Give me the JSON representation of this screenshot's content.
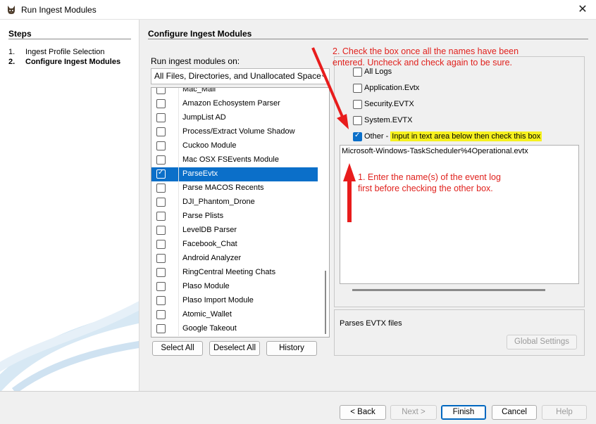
{
  "window": {
    "title": "Run Ingest Modules",
    "icon": "autopsy-dog-icon",
    "close_icon": "close-icon"
  },
  "steps": {
    "title": "Steps",
    "items": [
      {
        "num": "1.",
        "label": "Ingest Profile Selection"
      },
      {
        "num": "2.",
        "label": "Configure Ingest Modules"
      }
    ]
  },
  "main": {
    "title": "Configure Ingest Modules",
    "run_on_label": "Run ingest modules on:",
    "scope_value": "All Files, Directories, and Unallocated Space"
  },
  "modules": [
    {
      "name": "Mac_Mail",
      "checked": false,
      "selected": false
    },
    {
      "name": "Amazon Echosystem Parser",
      "checked": false,
      "selected": false
    },
    {
      "name": "JumpList AD",
      "checked": false,
      "selected": false
    },
    {
      "name": "Process/Extract Volume Shadow",
      "checked": false,
      "selected": false
    },
    {
      "name": "Cuckoo Module",
      "checked": false,
      "selected": false
    },
    {
      "name": "Mac OSX FSEvents Module",
      "checked": false,
      "selected": false
    },
    {
      "name": "ParseEvtx",
      "checked": true,
      "selected": true
    },
    {
      "name": "Parse MACOS Recents",
      "checked": false,
      "selected": false
    },
    {
      "name": "DJI_Phantom_Drone",
      "checked": false,
      "selected": false
    },
    {
      "name": "Parse Plists",
      "checked": false,
      "selected": false
    },
    {
      "name": "LevelDB Parser",
      "checked": false,
      "selected": false
    },
    {
      "name": "Facebook_Chat",
      "checked": false,
      "selected": false
    },
    {
      "name": "Android Analyzer",
      "checked": false,
      "selected": false
    },
    {
      "name": "RingCentral Meeting Chats",
      "checked": false,
      "selected": false
    },
    {
      "name": "Plaso Module",
      "checked": false,
      "selected": false
    },
    {
      "name": "Plaso Import Module",
      "checked": false,
      "selected": false
    },
    {
      "name": "Atomic_Wallet",
      "checked": false,
      "selected": false
    },
    {
      "name": "Google Takeout",
      "checked": false,
      "selected": false
    }
  ],
  "list_buttons": {
    "select_all": "Select All",
    "deselect_all": "Deselect All",
    "history": "History"
  },
  "settings": {
    "all_logs": "All Logs",
    "application": "Application.Evtx",
    "security": "Security.EVTX",
    "system": "System.EVTX",
    "other_label": "Other -",
    "other_hint": "Input in text area below then check this box",
    "other_checked": true,
    "log_text": "Microsoft-Windows-TaskScheduler%4Operational.evtx"
  },
  "description": {
    "text": "Parses EVTX files",
    "global_settings": "Global Settings"
  },
  "annotations": {
    "note2_line1": "2. Check the box once all the names have been",
    "note2_line2": "entered. Uncheck and check again to be sure.",
    "note1_line1": "1. Enter the name(s) of the event log",
    "note1_line2": "first before checking the other box.",
    "color": "#e0211d"
  },
  "footer": {
    "back": "< Back",
    "next": "Next >",
    "finish": "Finish",
    "cancel": "Cancel",
    "help": "Help"
  },
  "colors": {
    "selection": "#0b6fc9",
    "highlight": "#f6f11e"
  }
}
